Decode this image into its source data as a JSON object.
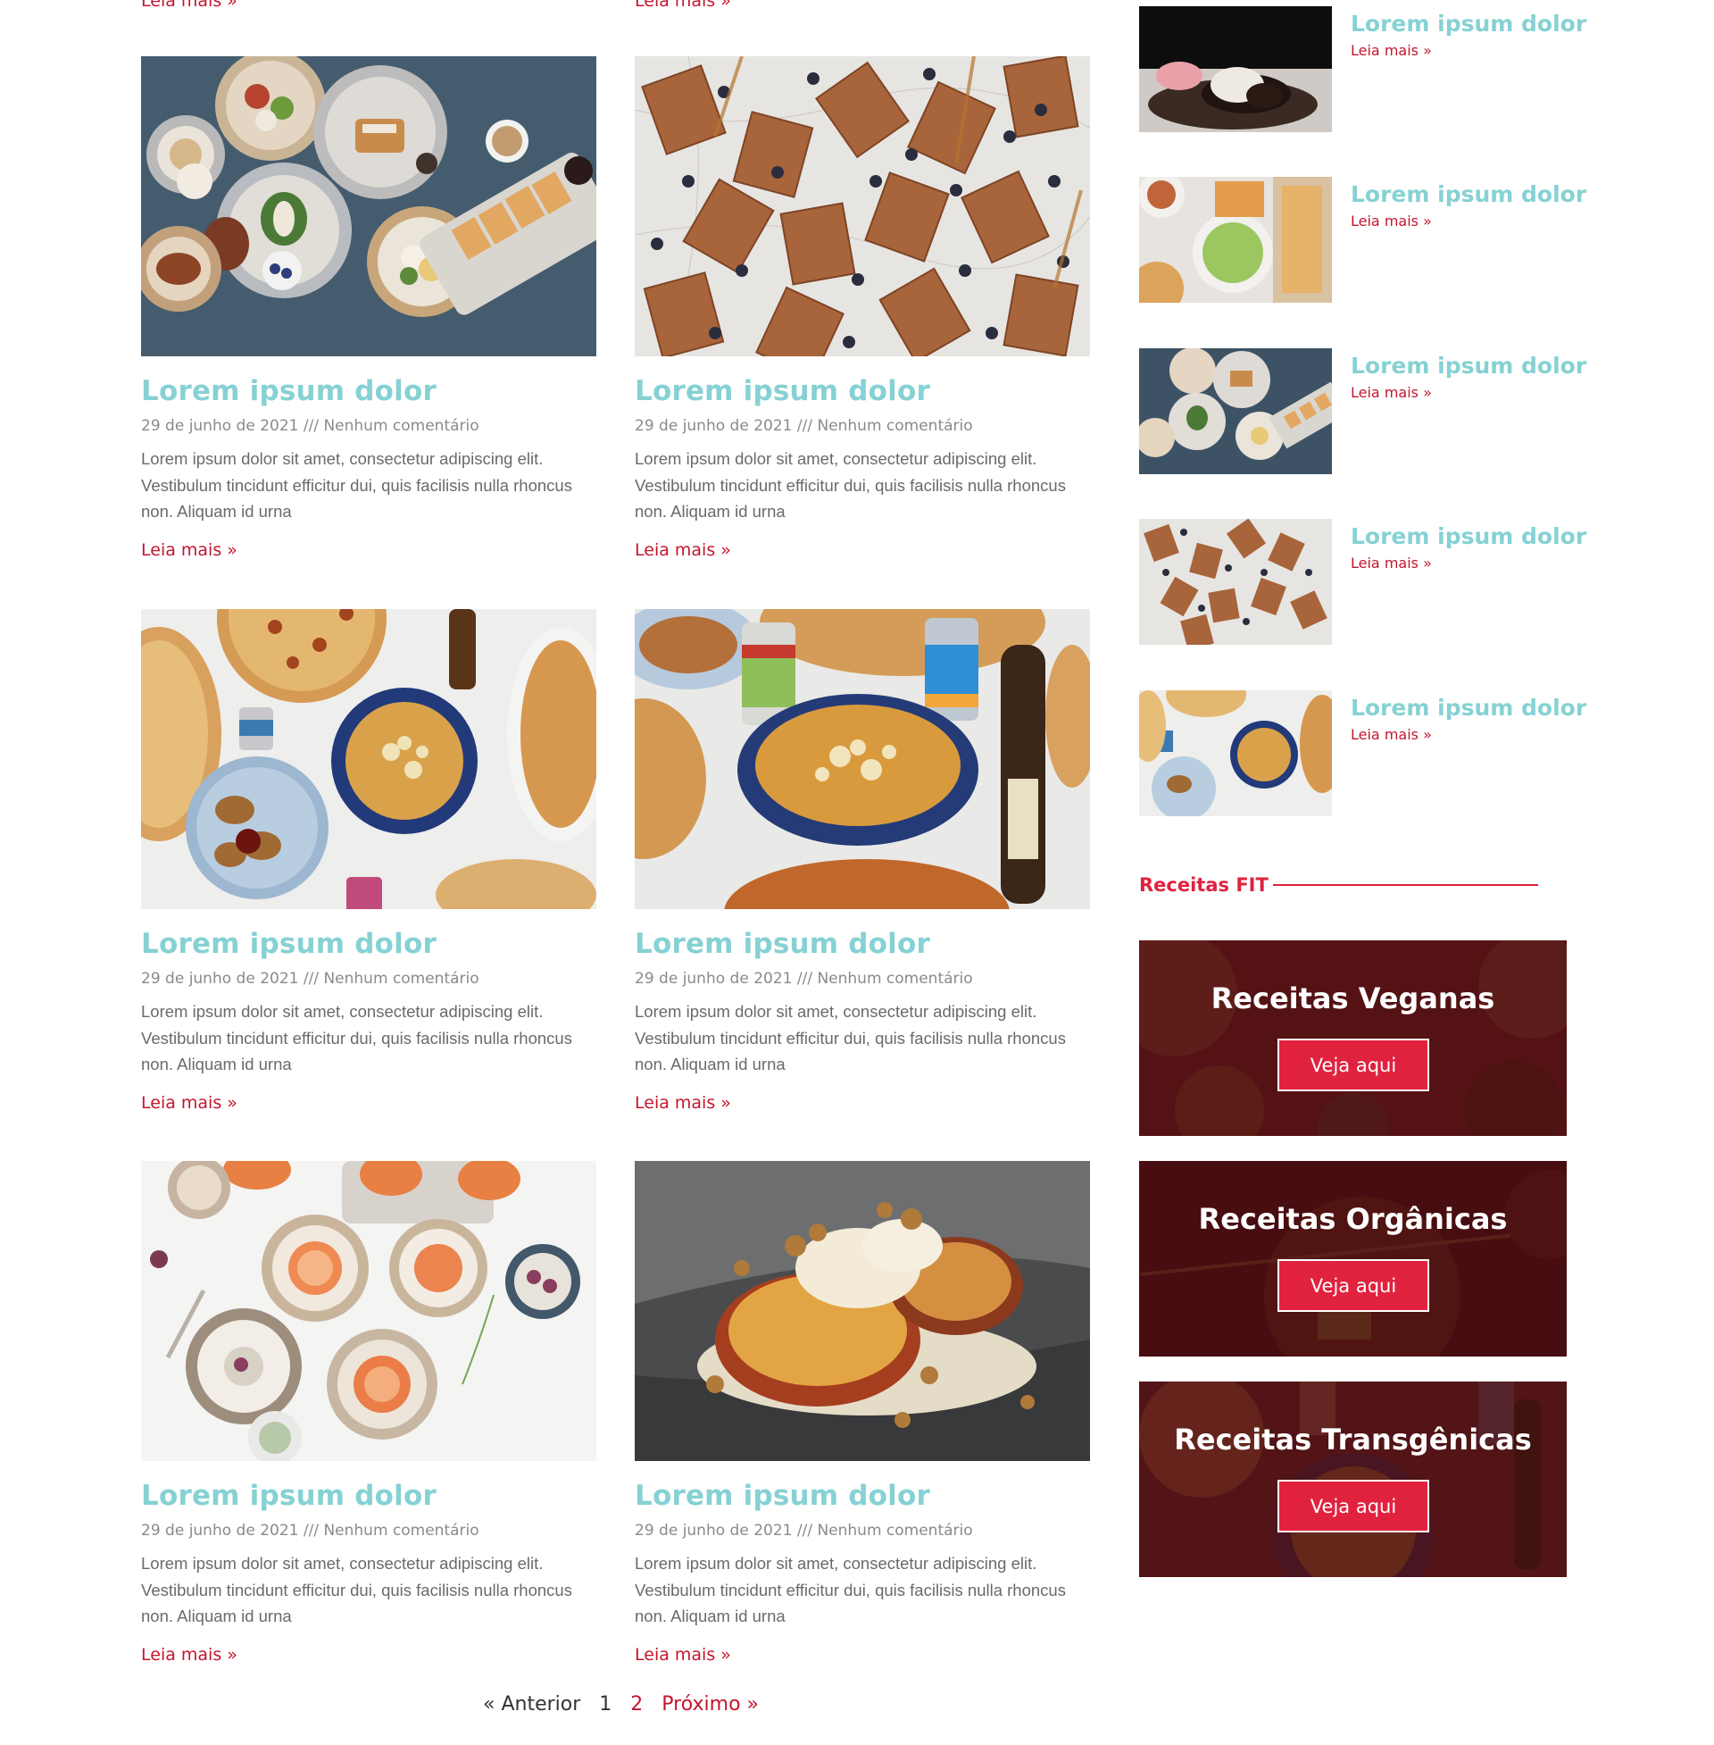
{
  "top_links": [
    "Leia mais »",
    "Leia mais »"
  ],
  "posts": [
    {
      "title": "Lorem ipsum dolor",
      "meta": "29 de junho de 2021 /// Nenhum comentário",
      "excerpt": "Lorem ipsum dolor sit amet, consectetur adipiscing elit. Vestibulum tincidunt efficitur dui, quis facilisis nulla rhoncus non. Aliquam id urna",
      "more": "Leia mais »",
      "image": "brunch-spread-photo"
    },
    {
      "title": "Lorem ipsum dolor",
      "meta": "29 de junho de 2021 /// Nenhum comentário",
      "excerpt": "Lorem ipsum dolor sit amet, consectetur adipiscing elit. Vestibulum tincidunt efficitur dui, quis facilisis nulla rhoncus non. Aliquam id urna",
      "more": "Leia mais »",
      "image": "waffles-blueberries-photo"
    },
    {
      "title": "Lorem ipsum dolor",
      "meta": "29 de junho de 2021 /// Nenhum comentário",
      "excerpt": "Lorem ipsum dolor sit amet, consectetur adipiscing elit. Vestibulum tincidunt efficitur dui, quis facilisis nulla rhoncus non. Aliquam id urna",
      "more": "Leia mais »",
      "image": "pizza-fries-table-photo"
    },
    {
      "title": "Lorem ipsum dolor",
      "meta": "29 de junho de 2021 /// Nenhum comentário",
      "excerpt": "Lorem ipsum dolor sit amet, consectetur adipiscing elit. Vestibulum tincidunt efficitur dui, quis facilisis nulla rhoncus non. Aliquam id urna",
      "more": "Leia mais »",
      "image": "fries-beer-pizza-photo"
    },
    {
      "title": "Lorem ipsum dolor",
      "meta": "29 de junho de 2021 /// Nenhum comentário",
      "excerpt": "Lorem ipsum dolor sit amet, consectetur adipiscing elit. Vestibulum tincidunt efficitur dui, quis facilisis nulla rhoncus non. Aliquam id urna",
      "more": "Leia mais »",
      "image": "grapefruit-figs-photo"
    },
    {
      "title": "Lorem ipsum dolor",
      "meta": "29 de junho de 2021 /// Nenhum comentário",
      "excerpt": "Lorem ipsum dolor sit amet, consectetur adipiscing elit. Vestibulum tincidunt efficitur dui, quis facilisis nulla rhoncus non. Aliquam id urna",
      "more": "Leia mais »",
      "image": "baked-peach-crumble-photo"
    }
  ],
  "sidebar": {
    "recent": [
      {
        "title": "Lorem ipsum dolor",
        "more": "Leia mais »",
        "image": "dessert-plate-photo"
      },
      {
        "title": "Lorem ipsum dolor",
        "more": "Leia mais »",
        "image": "salad-fries-photo"
      },
      {
        "title": "Lorem ipsum dolor",
        "more": "Leia mais »",
        "image": "brunch-spread-photo"
      },
      {
        "title": "Lorem ipsum dolor",
        "more": "Leia mais »",
        "image": "waffles-blueberries-photo"
      },
      {
        "title": "Lorem ipsum dolor",
        "more": "Leia mais »",
        "image": "pizza-fries-table-photo"
      }
    ],
    "fit_heading": "Receitas FIT",
    "ctas": [
      {
        "title": "Receitas Veganas",
        "button": "Veja aqui"
      },
      {
        "title": "Receitas Orgânicas",
        "button": "Veja aqui"
      },
      {
        "title": "Receitas Transgênicas",
        "button": "Veja aqui"
      }
    ]
  },
  "pagination": {
    "prev": "« Anterior",
    "current": "1",
    "page2": "2",
    "next": "Próximo »"
  },
  "colors": {
    "title": "#86d1d3",
    "link": "#c3162f",
    "accent": "#e0223f",
    "cta_overlay": "#4a0f12"
  }
}
